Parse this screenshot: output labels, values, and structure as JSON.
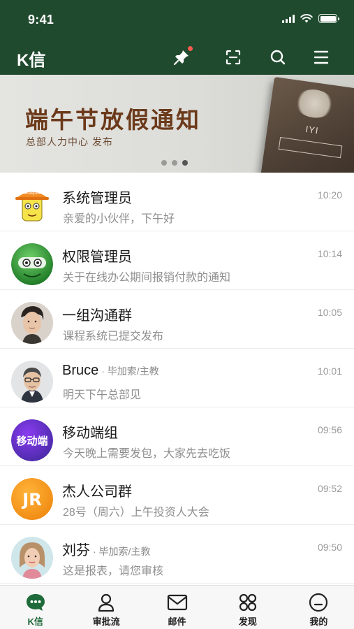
{
  "status_bar": {
    "time": "9:41"
  },
  "header": {
    "app_title": "K信",
    "icons": [
      "pin-icon",
      "scan-icon",
      "search-icon",
      "menu-icon"
    ],
    "background_color": "#1f4a2e",
    "pin_badge_color": "#ff5a4e"
  },
  "banner": {
    "title": "端午节放假通知",
    "subtitle": "总部人力中心 发布",
    "active_dot": 3,
    "dot_count": 3
  },
  "chats": [
    {
      "name": "系统管理员",
      "role": "",
      "preview": "亲爱的小伙伴，下午好",
      "time": "10:20",
      "avatar": "cartoon-hard-hat"
    },
    {
      "name": "权限管理员",
      "role": "",
      "preview": "关于在线办公期间报销付款的通知",
      "time": "10:14",
      "avatar": "green-robot"
    },
    {
      "name": "一组沟通群",
      "role": "",
      "preview": "课程系统已提交发布",
      "time": "10:05",
      "avatar": "person-photo"
    },
    {
      "name": "Bruce",
      "role": "· 毕加索/主教",
      "preview": "明天下午总部见",
      "time": "10:01",
      "avatar": "person-photo"
    },
    {
      "name": "移动端组",
      "role": "",
      "preview": "今天晚上需要发包，大家先去吃饭",
      "time": "09:56",
      "avatar_text": "移动端",
      "avatar": "purple-text"
    },
    {
      "name": "杰人公司群",
      "role": "",
      "preview": "28号（周六）上午投资人大会",
      "time": "09:52",
      "avatar_text": "JR",
      "avatar": "orange-text"
    },
    {
      "name": "刘芬",
      "role": "· 毕加索/主教",
      "preview": "这是报表，请您审核",
      "time": "09:50",
      "avatar": "person-photo"
    }
  ],
  "tabs": [
    {
      "label": "K信",
      "icon": "chat-bubble-icon",
      "active": true
    },
    {
      "label": "审批流",
      "icon": "user-icon",
      "active": false
    },
    {
      "label": "邮件",
      "icon": "mail-icon",
      "active": false
    },
    {
      "label": "发现",
      "icon": "grid-icon",
      "active": false
    },
    {
      "label": "我的",
      "icon": "face-icon",
      "active": false
    }
  ],
  "accent_color": "#1f6a3a"
}
